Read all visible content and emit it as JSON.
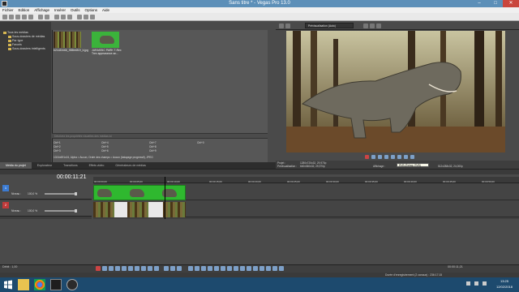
{
  "window": {
    "title": "Sans titre * - Vegas Pro 13.0",
    "min": "–",
    "max": "□",
    "close": "✕"
  },
  "menu": [
    "Fichier",
    "Edition",
    "Affichage",
    "Insérer",
    "Outils",
    "Options",
    "Aide"
  ],
  "explorer": {
    "items": [
      "Tous les médias",
      "Sous-dossiers de médias",
      "Par type",
      "Favoris",
      "Sous-dossiers intelligents"
    ]
  },
  "media": {
    "items": [
      {
        "caption": "b21183466_398fe6f19_b.jpg"
      },
      {
        "caption": "JURASSIC PARK T-Rex Trex appearance an..."
      }
    ],
    "search_placeholder": "Décrivez les propriétés visuelles des médias ici",
    "shortcuts": [
      [
        "Ctrl+1",
        "Ctrl+4",
        "Ctrl+7",
        "Ctrl+0"
      ],
      [
        "Ctrl+2",
        "Ctrl+5",
        "Ctrl+8"
      ],
      [
        "Ctrl+3",
        "Ctrl+6",
        "Ctrl+9"
      ]
    ],
    "info": "1024x691x24, Alpha = Aucun, Ordre des champs = Aucun (balayage progressif), JPEG"
  },
  "tabs": [
    "Média du projet",
    "Explorateur",
    "Transitions",
    "Effets vidéo",
    "Générateurs de médias"
  ],
  "preview": {
    "quality": "Prévisualisation (Auto)",
    "info": [
      [
        "Projet :",
        "1280x720x32, 29,970p"
      ],
      [
        "Prévisualisation :",
        "640x360x32, 29,970p"
      ],
      [
        "Affichage :",
        "",
        "Vidéo (Échap. RGB)",
        "512x288x32, 24,000p"
      ]
    ],
    "tooltip": "RVB (Échap. RVB)"
  },
  "timeline": {
    "timecode": "00:00:11:21",
    "ruler": [
      "00:00:00;00",
      "00:00:05;00",
      "00:00:10;00",
      "00:00:15;00",
      "00:00:20;00",
      "00:00:25;00",
      "00:00:30;00",
      "00:00:35;00",
      "00:00:40;00",
      "00:00:45;00",
      "00:00:50;00"
    ],
    "tracks": [
      {
        "num": "1",
        "vol_label": "Niveau :",
        "vol": "100,0 %"
      },
      {
        "num": "2",
        "vol_label": "Niveau :",
        "vol": "100,0 %"
      }
    ]
  },
  "transport": {
    "rate": "Débit : 1,00",
    "time": "00:00:11;21"
  },
  "status": "Durée d'enregistrement (2 canaux) : 236:17:15",
  "tray": {
    "time": "13:25",
    "date": "12/02/2018"
  },
  "colors": {
    "titlebar": "#5c8fb8",
    "accent_green": "#2fb82f",
    "taskbar": "#1d4a6e"
  }
}
